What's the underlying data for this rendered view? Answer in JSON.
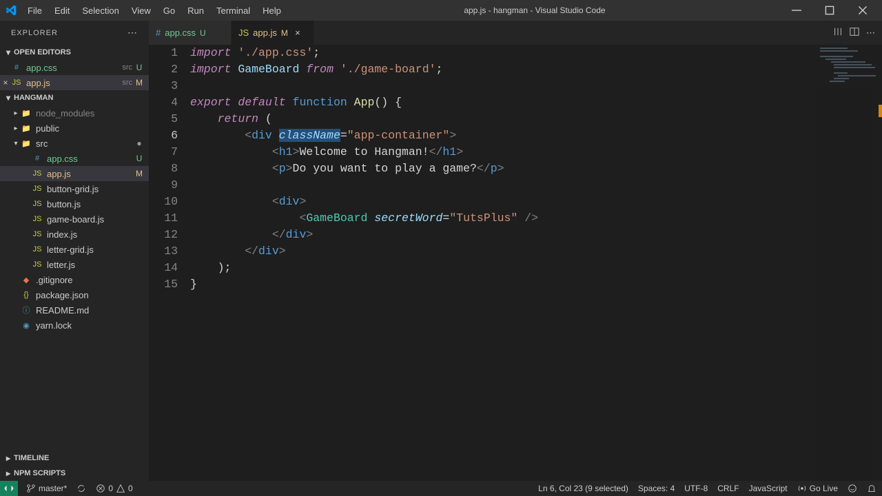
{
  "window": {
    "title": "app.js - hangman - Visual Studio Code"
  },
  "menu": [
    "File",
    "Edit",
    "Selection",
    "View",
    "Go",
    "Run",
    "Terminal",
    "Help"
  ],
  "sidebar": {
    "title": "EXPLORER",
    "sections": {
      "open_editors": "OPEN EDITORS",
      "project": "HANGMAN",
      "timeline": "TIMELINE",
      "npm": "NPM SCRIPTS"
    },
    "open_editors": [
      {
        "name": "app.css",
        "dir": "src",
        "badge": "U",
        "close": false
      },
      {
        "name": "app.js",
        "dir": "src",
        "badge": "M",
        "close": true
      }
    ],
    "tree": [
      {
        "name": "node_modules",
        "type": "folder",
        "muted": true,
        "expanded": false,
        "indent": 1
      },
      {
        "name": "public",
        "type": "folder",
        "expanded": false,
        "indent": 1
      },
      {
        "name": "src",
        "type": "folder",
        "expanded": true,
        "dot": true,
        "indent": 1
      },
      {
        "name": "app.css",
        "type": "css",
        "badge": "U",
        "indent": 2
      },
      {
        "name": "app.js",
        "type": "js",
        "badge": "M",
        "indent": 2,
        "active": true
      },
      {
        "name": "button-grid.js",
        "type": "js",
        "indent": 2
      },
      {
        "name": "button.js",
        "type": "js",
        "indent": 2
      },
      {
        "name": "game-board.js",
        "type": "js",
        "indent": 2
      },
      {
        "name": "index.js",
        "type": "js",
        "indent": 2
      },
      {
        "name": "letter-grid.js",
        "type": "js",
        "indent": 2
      },
      {
        "name": "letter.js",
        "type": "js",
        "indent": 2
      },
      {
        "name": ".gitignore",
        "type": "git",
        "indent": 1
      },
      {
        "name": "package.json",
        "type": "json",
        "indent": 1
      },
      {
        "name": "README.md",
        "type": "md",
        "indent": 1
      },
      {
        "name": "yarn.lock",
        "type": "yarn",
        "indent": 1
      }
    ]
  },
  "tabs": [
    {
      "name": "app.css",
      "icon": "css",
      "badge": "U",
      "badgeClass": "u",
      "active": false,
      "close": false
    },
    {
      "name": "app.js",
      "icon": "js",
      "badge": "M",
      "badgeClass": "m",
      "active": true,
      "close": true
    }
  ],
  "editor": {
    "lines": 15,
    "current_line": 6,
    "code_html": [
      "<span class='tk-keyword'>import</span> <span class='tk-string'>'./app.css'</span>;",
      "<span class='tk-keyword'>import</span> <span class='tk-var'>GameBoard</span> <span class='tk-keyword'>from</span> <span class='tk-string'>'./game-board'</span>;",
      "",
      "<span class='tk-keyword'>export</span> <span class='tk-keyword'>default</span> <span class='tk-keyword2'>function</span> <span class='tk-func'>App</span>() {",
      "    <span class='tk-keyword'>return</span> (",
      "        <span class='tk-punct'>&lt;</span><span class='tk-tag'>div</span> <span class='sel'><span class='tk-attr'>className</span></span><span class='tk-brace'>=</span><span class='tk-string'>\"app-container\"</span><span class='tk-punct'>&gt;</span>",
      "            <span class='tk-punct'>&lt;</span><span class='tk-tag'>h1</span><span class='tk-punct'>&gt;</span>Welcome to Hangman!<span class='tk-punct'>&lt;/</span><span class='tk-tag'>h1</span><span class='tk-punct'>&gt;</span>",
      "            <span class='tk-punct'>&lt;</span><span class='tk-tag'>p</span><span class='tk-punct'>&gt;</span>Do you want to play a game?<span class='tk-punct'>&lt;/</span><span class='tk-tag'>p</span><span class='tk-punct'>&gt;</span>",
      "",
      "            <span class='tk-punct'>&lt;</span><span class='tk-tag'>div</span><span class='tk-punct'>&gt;</span>",
      "                <span class='tk-punct'>&lt;</span><span class='tk-type'>GameBoard</span> <span class='tk-attr'>secretWord</span><span class='tk-brace'>=</span><span class='tk-string'>\"TutsPlus\"</span> <span class='tk-punct'>/&gt;</span>",
      "            <span class='tk-punct'>&lt;/</span><span class='tk-tag'>div</span><span class='tk-punct'>&gt;</span>",
      "        <span class='tk-punct'>&lt;/</span><span class='tk-tag'>div</span><span class='tk-punct'>&gt;</span>",
      "    );",
      "}"
    ]
  },
  "statusbar": {
    "branch": "master*",
    "errors": "0",
    "warnings": "0",
    "cursor": "Ln 6, Col 23 (9 selected)",
    "spaces": "Spaces: 4",
    "encoding": "UTF-8",
    "eol": "CRLF",
    "lang": "JavaScript",
    "golive": "Go Live"
  }
}
